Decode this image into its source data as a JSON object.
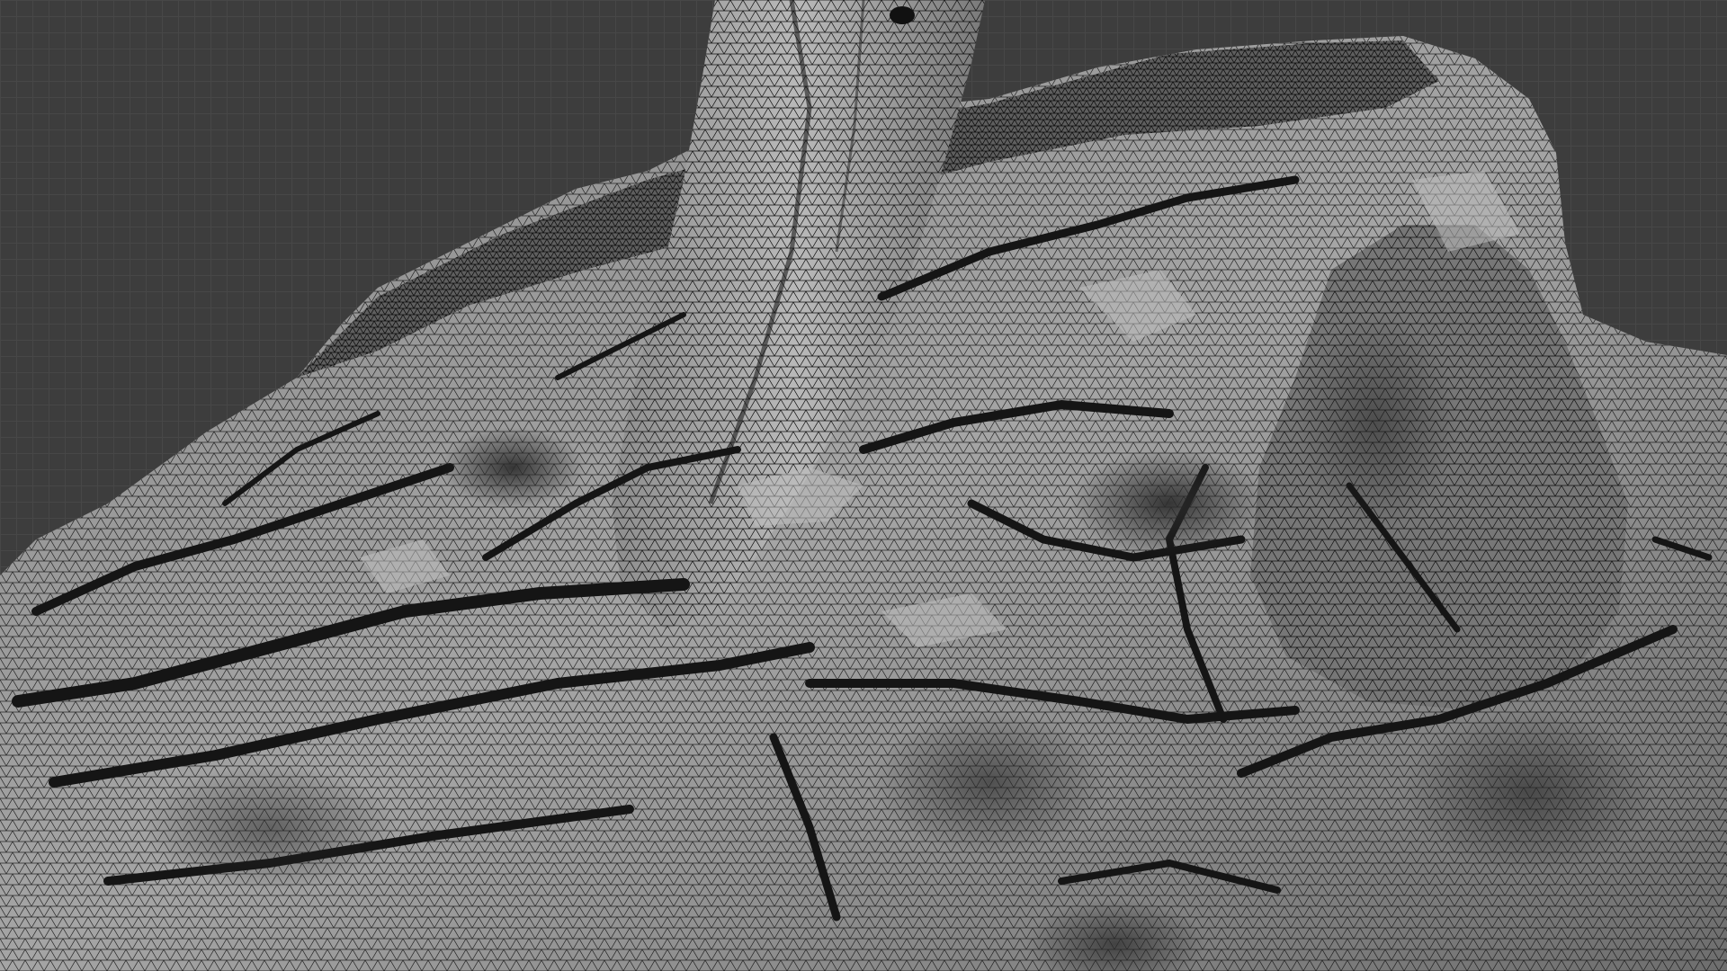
{
  "viewport": {
    "background_color": "#3d3d3d",
    "grid_line_color": "#474747",
    "grid_major_color": "#4f4f4f",
    "shading_mode": "wireframe-overlay"
  },
  "mesh": {
    "object_description": "",
    "surface_color": "#9b9b9b",
    "wire_color": "#111111",
    "cavity_color": "#161616"
  }
}
